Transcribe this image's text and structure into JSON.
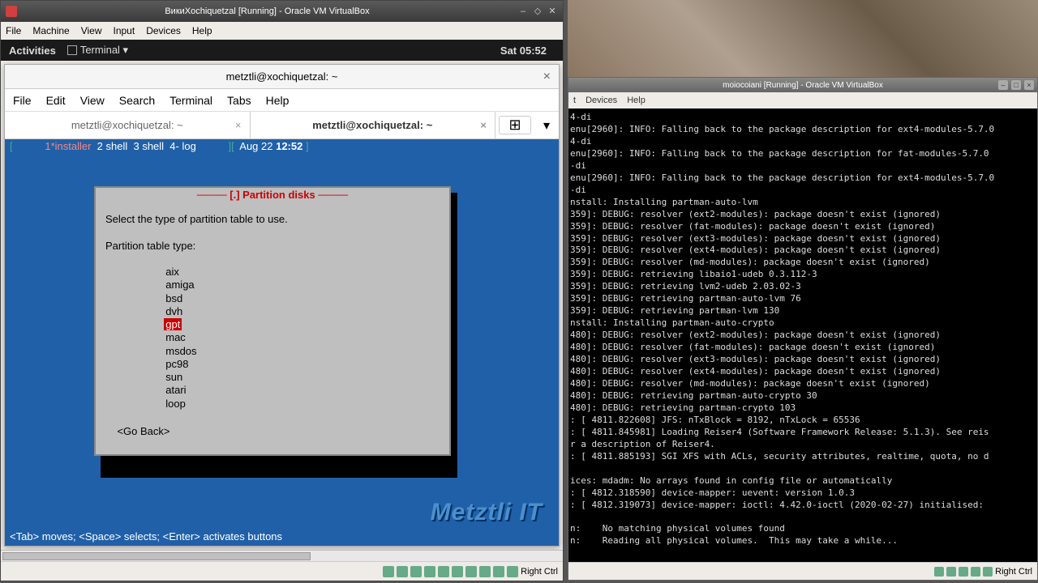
{
  "vm1": {
    "title": "ВикиXochiquetzal [Running] - Oracle VM VirtualBox",
    "menu": [
      "File",
      "Machine",
      "View",
      "Input",
      "Devices",
      "Help"
    ],
    "status_key": "Right Ctrl"
  },
  "gnome": {
    "activities": "Activities",
    "app": "Terminal ▾",
    "clock": "Sat 05:52"
  },
  "terminal": {
    "title": "metztli@xochiquetzal: ~",
    "menu": [
      "File",
      "Edit",
      "View",
      "Search",
      "Terminal",
      "Tabs",
      "Help"
    ],
    "tabs": [
      {
        "label": "metztli@xochiquetzal: ~",
        "active": false
      },
      {
        "label": "metztli@xochiquetzal: ~",
        "active": true
      }
    ],
    "status_left": "[           1*installer  2 shell  3 shell  4- log           ][  Aug 22 12:52 ]",
    "dialog": {
      "title": "[.] Partition disks",
      "prompt": "Select the type of partition table to use.",
      "label": "Partition table type:",
      "options": [
        "aix",
        "amiga",
        "bsd",
        "dvh",
        "gpt",
        "mac",
        "msdos",
        "pc98",
        "sun",
        "atari",
        "loop"
      ],
      "selected": "gpt",
      "goback": "<Go Back>"
    },
    "hint": "<Tab> moves; <Space> selects; <Enter> activates buttons",
    "watermark": "Metztli IT"
  },
  "vm2": {
    "title": "moiocoiani [Running] - Oracle VM VirtualBox",
    "menu": [
      "t",
      "Devices",
      "Help"
    ],
    "status_key": "Right Ctrl",
    "log": [
      "4-di",
      "enu[2960]: INFO: Falling back to the package description for ext4-modules-5.7.0",
      "4-di",
      "enu[2960]: INFO: Falling back to the package description for fat-modules-5.7.0",
      "-di",
      "enu[2960]: INFO: Falling back to the package description for ext4-modules-5.7.0",
      "-di",
      "nstall: Installing partman-auto-lvm",
      "359]: DEBUG: resolver (ext2-modules): package doesn't exist (ignored)",
      "359]: DEBUG: resolver (fat-modules): package doesn't exist (ignored)",
      "359]: DEBUG: resolver (ext3-modules): package doesn't exist (ignored)",
      "359]: DEBUG: resolver (ext4-modules): package doesn't exist (ignored)",
      "359]: DEBUG: resolver (md-modules): package doesn't exist (ignored)",
      "359]: DEBUG: retrieving libaio1-udeb 0.3.112-3",
      "359]: DEBUG: retrieving lvm2-udeb 2.03.02-3",
      "359]: DEBUG: retrieving partman-auto-lvm 76",
      "359]: DEBUG: retrieving partman-lvm 130",
      "nstall: Installing partman-auto-crypto",
      "480]: DEBUG: resolver (ext2-modules): package doesn't exist (ignored)",
      "480]: DEBUG: resolver (fat-modules): package doesn't exist (ignored)",
      "480]: DEBUG: resolver (ext3-modules): package doesn't exist (ignored)",
      "480]: DEBUG: resolver (ext4-modules): package doesn't exist (ignored)",
      "480]: DEBUG: resolver (md-modules): package doesn't exist (ignored)",
      "480]: DEBUG: retrieving partman-auto-crypto 30",
      "480]: DEBUG: retrieving partman-crypto 103",
      ": [ 4811.822608] JFS: nTxBlock = 8192, nTxLock = 65536",
      ": [ 4811.845981] Loading Reiser4 (Software Framework Release: 5.1.3). See reis",
      "r a description of Reiser4.",
      ": [ 4811.885193] SGI XFS with ACLs, security attributes, realtime, quota, no d",
      "",
      "ices: mdadm: No arrays found in config file or automatically",
      ": [ 4812.318590] device-mapper: uevent: version 1.0.3",
      ": [ 4812.319073] device-mapper: ioctl: 4.42.0-ioctl (2020-02-27) initialised:",
      "",
      "n:    No matching physical volumes found",
      "n:    Reading all physical volumes.  This may take a while..."
    ]
  }
}
